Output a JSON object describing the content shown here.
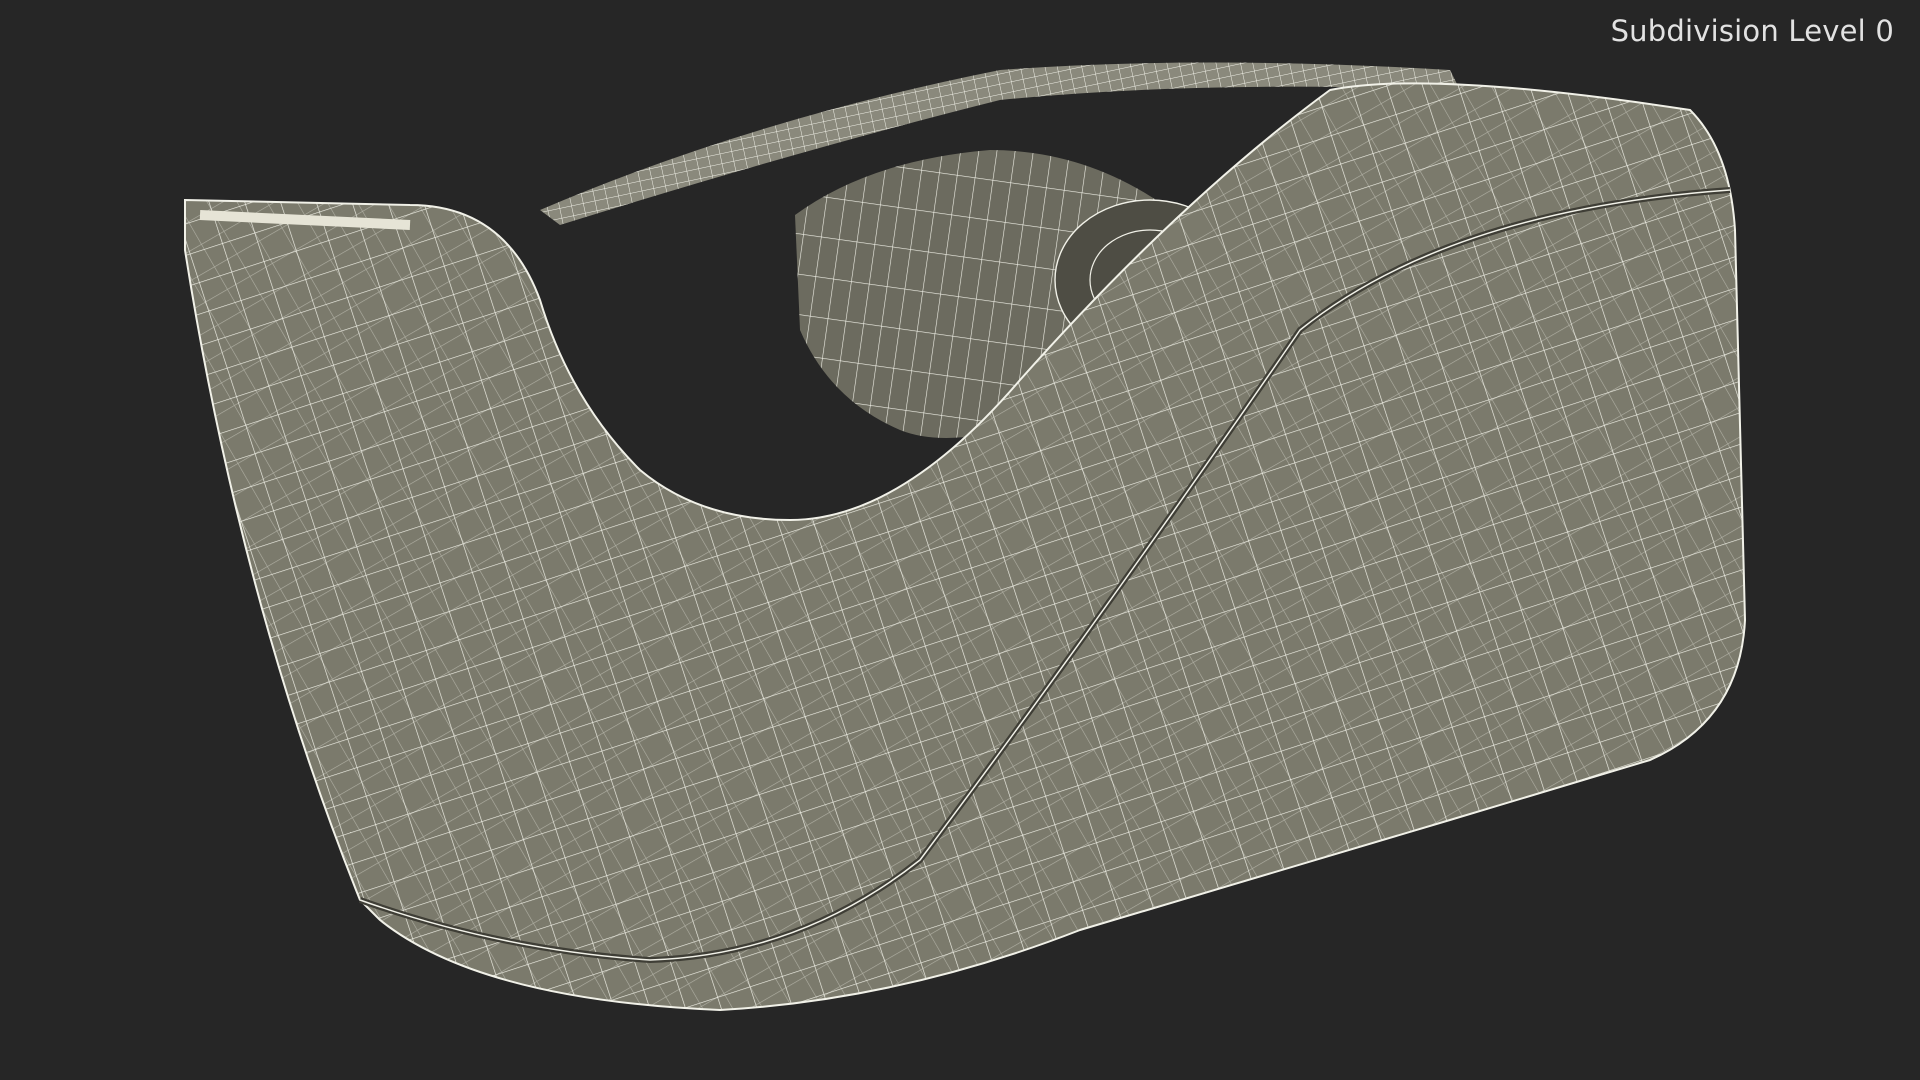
{
  "viewport": {
    "label": "Subdivision Level 0",
    "background": "#262626"
  },
  "model": {
    "subject": "tape-dispenser-wireframe",
    "surface_color": "#7b7a6c",
    "wire_color": "#f1f1e8"
  }
}
